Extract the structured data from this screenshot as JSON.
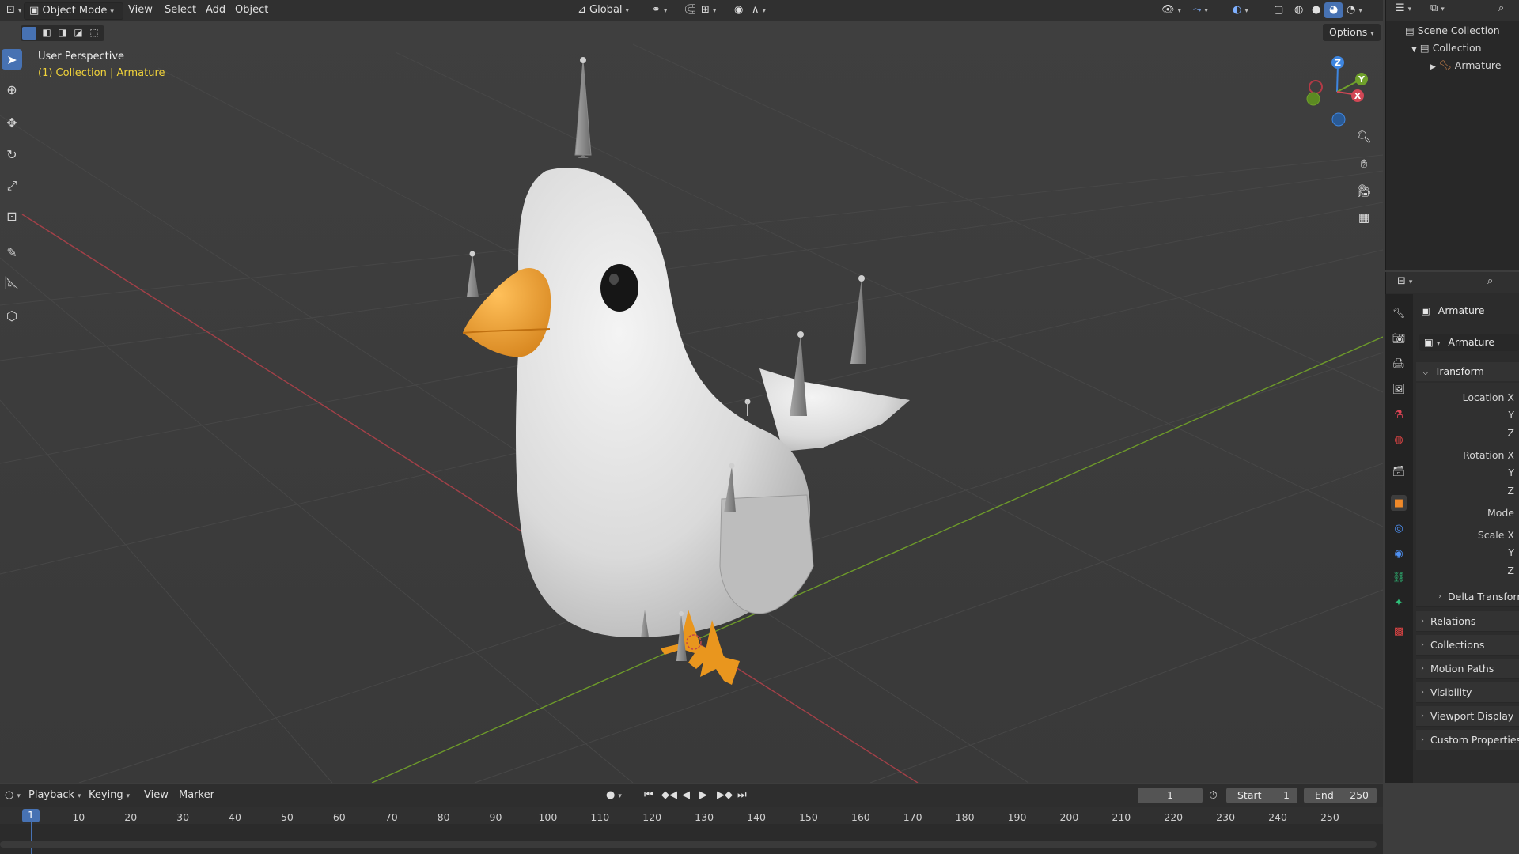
{
  "header": {
    "mode": "Object Mode",
    "menus": [
      "View",
      "Select",
      "Add",
      "Object"
    ],
    "orientation": "Global",
    "options_label": "Options"
  },
  "viewport": {
    "title": "User Perspective",
    "subtitle": "(1) Collection | Armature",
    "gizmo": {
      "z": "Z",
      "y": "Y",
      "x": "X"
    }
  },
  "outliner": {
    "scene_collection": "Scene Collection",
    "collection": "Collection",
    "armature": "Armature"
  },
  "properties": {
    "object_name": "Armature",
    "data_name": "Armature",
    "transform_label": "Transform",
    "fields": {
      "location_x": "Location X",
      "y1": "Y",
      "z1": "Z",
      "rotation_x": "Rotation X",
      "y2": "Y",
      "z2": "Z",
      "mode": "Mode",
      "scale_x": "Scale X",
      "y3": "Y",
      "z3": "Z"
    },
    "panels": [
      "Delta Transform",
      "Relations",
      "Collections",
      "Motion Paths",
      "Visibility",
      "Viewport Display",
      "Custom Properties"
    ]
  },
  "timeline": {
    "menus": [
      "Playback",
      "Keying",
      "View",
      "Marker"
    ],
    "current_frame": "1",
    "start_label": "Start",
    "start_value": "1",
    "end_label": "End",
    "end_value": "250",
    "playhead": "1",
    "ticks": [
      "10",
      "20",
      "30",
      "40",
      "50",
      "60",
      "70",
      "80",
      "90",
      "100",
      "110",
      "120",
      "130",
      "140",
      "150",
      "160",
      "170",
      "180",
      "190",
      "200",
      "210",
      "220",
      "230",
      "240",
      "250"
    ]
  },
  "colors": {
    "accent": "#4772b3",
    "subtitle": "#f0d23a",
    "x_axis": "#b3414a",
    "y_axis": "#6e9a2b"
  }
}
